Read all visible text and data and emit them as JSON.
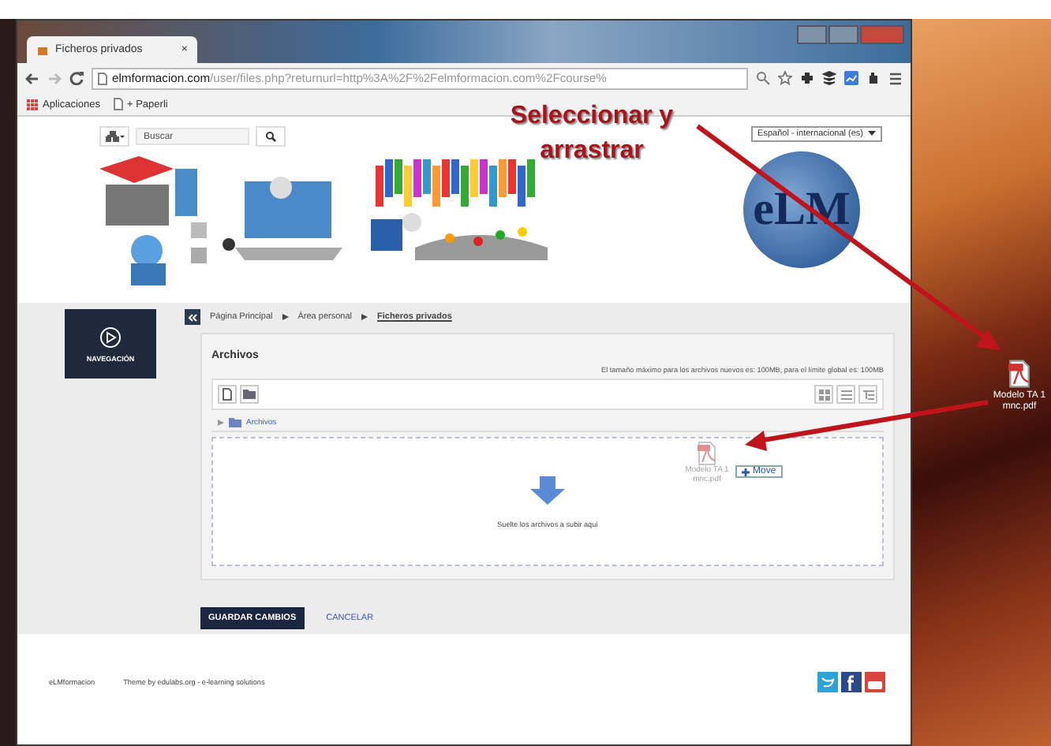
{
  "browser": {
    "tab": {
      "title": "Ficheros privados",
      "close": "×"
    },
    "address": {
      "host": "elmformacion.com",
      "path": "/user/files.php?returnurl=http%3A%2F%2Felmformacion.com%2Fcourse%"
    },
    "bookmarks": [
      {
        "label": "Aplicaciones"
      },
      {
        "label": "+ Paperli"
      }
    ]
  },
  "header": {
    "search": {
      "placeholder": "Buscar"
    },
    "language": "Español - internacional (es)",
    "logo": "eLM"
  },
  "sidebar": {
    "label": "NAVEGACIÓN"
  },
  "breadcrumb": [
    {
      "label": "Página Principal",
      "current": false
    },
    {
      "label": "Área personal",
      "current": false
    },
    {
      "label": "Ficheros privados",
      "current": true
    }
  ],
  "files": {
    "title": "Archivos",
    "limit_note": "El tamaño máximo para los archivos nuevos es: 100MB, para el límite global es: 100MB",
    "path": "Archivos",
    "drop_hint": "Suelte los archivos a subir aquí",
    "dragged_file": {
      "name": "Modelo TA 1 mnc.pdf",
      "tooltip": "Move"
    }
  },
  "buttons": [
    {
      "label": "GUARDAR CAMBIOS",
      "kind": "primary"
    },
    {
      "label": "CANCELAR",
      "kind": "link"
    }
  ],
  "footer": {
    "site": "eLMformacion",
    "credit": "Theme by edulabs.org - e-learning solutions"
  },
  "annotation": {
    "text": "Seleccionar y arrastrar"
  },
  "desktop_icon": {
    "label": "Modelo TA 1 mnc.pdf"
  }
}
